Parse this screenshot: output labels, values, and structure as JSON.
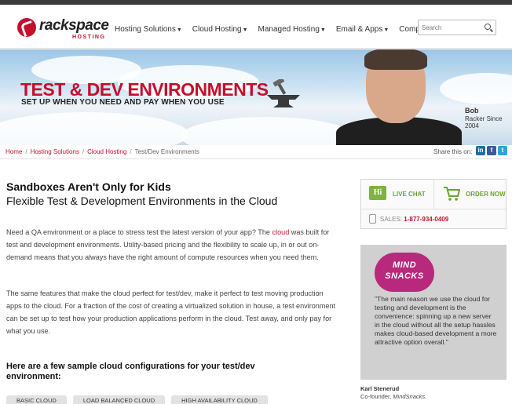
{
  "brand": {
    "name": "rackspace",
    "tagline": "HOSTING",
    "accent": "#c40f2d"
  },
  "nav": {
    "items": [
      {
        "label": "Hosting Solutions"
      },
      {
        "label": "Cloud Hosting"
      },
      {
        "label": "Managed Hosting"
      },
      {
        "label": "Email & Apps"
      },
      {
        "label": "Company"
      }
    ]
  },
  "search": {
    "placeholder": "Search"
  },
  "hero": {
    "title": "TEST & DEV ENVIRONMENTS",
    "subtitle": "SET UP WHEN YOU NEED AND PAY WHEN YOU USE",
    "caption_name": "Bob",
    "caption_role": "Racker Since 2004"
  },
  "breadcrumb": {
    "items": [
      "Home",
      "Hosting Solutions",
      "Cloud Hosting"
    ],
    "current": "Test/Dev Environments"
  },
  "share": {
    "label": "Share this on:",
    "icons": [
      "linkedin-icon",
      "facebook-icon",
      "twitter-icon"
    ]
  },
  "main": {
    "heading": "Sandboxes Aren't Only for Kids",
    "subheading": "Flexible Test & Development Environments in the Cloud",
    "para1_before": "Need a QA environment or a place to stress test the latest version of your app? The ",
    "para1_link": "cloud",
    "para1_after": " was built for test and development environments. Utility-based pricing and the flexibility to scale up, in or out on-demand means that you always have the right amount of compute resources when you need them.",
    "para2": "The same features that make the cloud perfect for test/dev, make it perfect to test moving production apps to the cloud. For a fraction of the cost of creating a virtualized solution in house, a test environment can be set up to test how your production applications perform in the cloud. Test away, and only pay for what you use.",
    "configs_heading": "Here are a few sample cloud configurations for your test/dev environment:",
    "tabs": [
      "BASIC CLOUD",
      "LOAD BALANCED CLOUD",
      "HIGH AVAILABILITY CLOUD"
    ]
  },
  "sidebar": {
    "chat_icon_text": "Hi",
    "live_chat": "LIVE CHAT",
    "order_now": "ORDER NOW",
    "sales_label": "SALES:",
    "sales_phone": "1-877-934-0409",
    "testimonial": {
      "logo_line1": "MIND",
      "logo_line2": "SNACKS",
      "quote": "\"The main reason we use the cloud for testing and development is the convenience: spinning up a new server in the cloud without all the setup hassles makes cloud-based development a more attractive option overall.\"",
      "author": "Karl Stenerud",
      "role_prefix": "Co-founder, ",
      "company": "MindSnacks."
    }
  }
}
